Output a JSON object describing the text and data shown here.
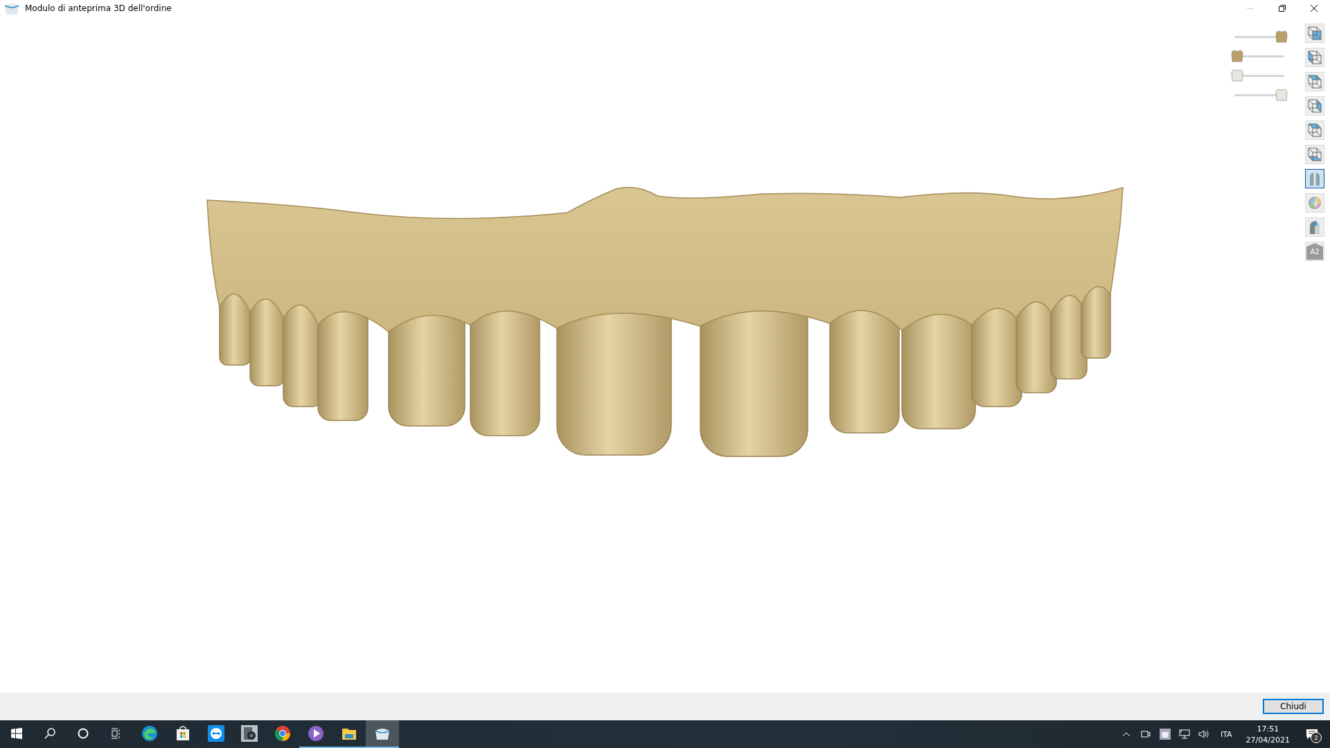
{
  "window": {
    "title": "Modulo di anteprima 3D dell'ordine"
  },
  "sliders": [
    {
      "kind": "stump",
      "level": 1
    },
    {
      "kind": "crown-gold",
      "level": 0
    },
    {
      "kind": "crown-white",
      "level": 0
    },
    {
      "kind": "crown-white",
      "level": 1
    }
  ],
  "view_buttons": [
    {
      "kind": "cube-front",
      "selected": false
    },
    {
      "kind": "cube-left",
      "selected": false
    },
    {
      "kind": "cube-top-left",
      "selected": false
    },
    {
      "kind": "cube-right",
      "selected": false
    },
    {
      "kind": "cube-top",
      "selected": false
    },
    {
      "kind": "cube-bottom",
      "selected": false
    },
    {
      "kind": "shading",
      "selected": true
    },
    {
      "kind": "color",
      "selected": false
    },
    {
      "kind": "section",
      "selected": false
    },
    {
      "kind": "shade",
      "label": "A2",
      "selected": false
    }
  ],
  "footer": {
    "close_button": "Chiudi"
  },
  "taskbar": {
    "apps": [
      {
        "kind": "edge",
        "running": false,
        "selected": false
      },
      {
        "kind": "store",
        "running": false,
        "selected": false
      },
      {
        "kind": "remote",
        "running": false,
        "selected": false
      },
      {
        "kind": "camera",
        "running": false,
        "selected": false
      },
      {
        "kind": "chrome",
        "running": false,
        "selected": false
      },
      {
        "kind": "player",
        "running": true,
        "selected": false
      },
      {
        "kind": "folder",
        "running": true,
        "selected": false
      },
      {
        "kind": "dental",
        "running": true,
        "selected": true
      }
    ],
    "language": "ITA",
    "time": "17:51",
    "date": "27/04/2021",
    "notifications": "2"
  }
}
